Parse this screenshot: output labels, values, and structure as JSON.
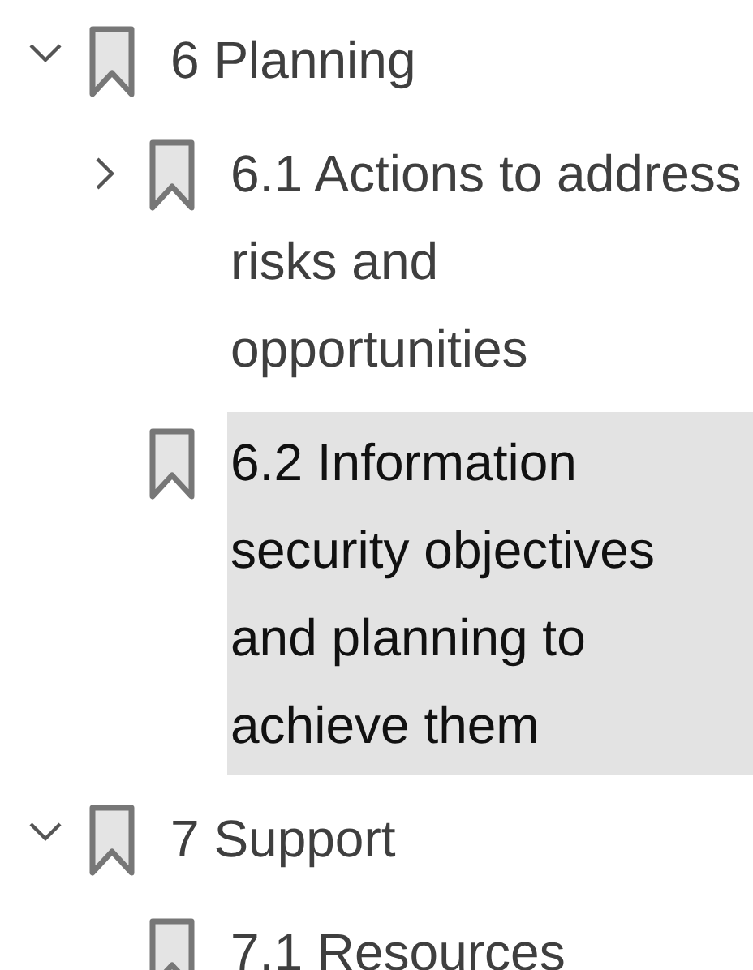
{
  "bookmarks": [
    {
      "label": "6 Planning",
      "expanded": true,
      "selected": false,
      "children": [
        {
          "label": "6.1 Actions to address risks and opportunities",
          "expanded": false,
          "selected": false
        },
        {
          "label": "6.2 Information security objectives and planning to achieve them",
          "selected": true
        }
      ]
    },
    {
      "label": "7 Support",
      "expanded": true,
      "selected": false,
      "children": [
        {
          "label": "7.1 Resources",
          "selected": false
        }
      ]
    }
  ]
}
